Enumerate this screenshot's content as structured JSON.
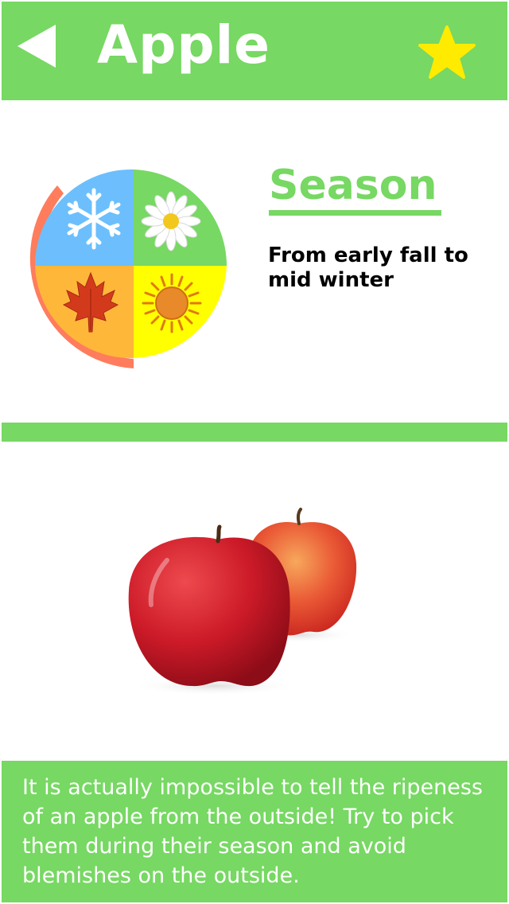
{
  "header": {
    "title": "Apple",
    "back_icon": "back-arrow-icon",
    "favorite_icon": "star-icon"
  },
  "season": {
    "heading": "Season",
    "description": "From early fall to mid winter",
    "icons": [
      "snowflake-icon",
      "daisy-icon",
      "maple-leaf-icon",
      "sun-icon"
    ]
  },
  "photo": {
    "subject": "apple-photo"
  },
  "tip": {
    "text": "It is actually impossible to tell the ripeness of an apple from the outside! Try to pick them during their season and avoid blemishes on the outside."
  },
  "colors": {
    "accent_green": "#77d863",
    "star_yellow": "#ffeb00",
    "winter_blue": "#6cbffc",
    "spring_green": "#77d863",
    "fall_orange": "#ffb73a",
    "summer_yellow": "#ffff00",
    "season_range_coral": "#ff7c5c"
  }
}
